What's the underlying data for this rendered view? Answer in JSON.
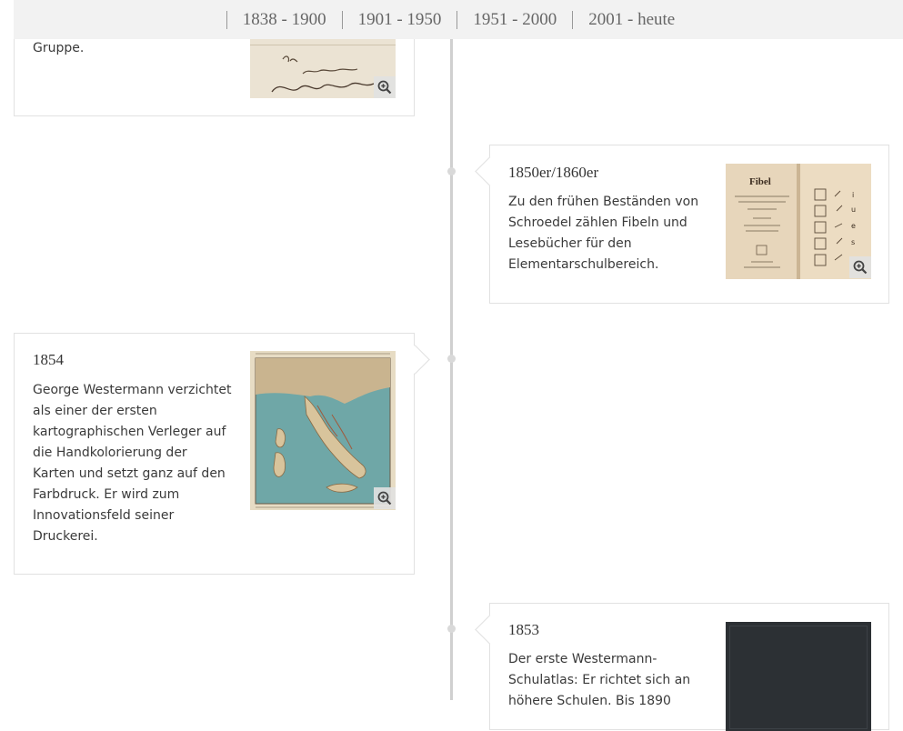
{
  "nav": {
    "items": [
      "1838 - 1900",
      "1901 - 1950",
      "1951 - 2000",
      "2001 - heute"
    ]
  },
  "cards": [
    {
      "year": "",
      "text": "Gruppe.",
      "image_label": "handwritten signature document",
      "handwriting": [
        "Ihr",
        "ergebenster",
        "Schroedel & Simon"
      ]
    },
    {
      "year": "1850er/1860er",
      "text": "Zu den frühen Beständen von Schroedel zählen Fibeln und Lesebücher für den Elementarschulbereich.",
      "image_label": "Fibel book pages",
      "book_title": "Fibel"
    },
    {
      "year": "1854",
      "text": "George Westermann verzichtet als einer der ersten kartographischen Verleger auf die Handkolorierung der Karten und setzt ganz auf den Farbdruck. Er wird zum Innovationsfeld seiner Druckerei.",
      "image_label": "Italy map"
    },
    {
      "year": "1853",
      "text": "Der erste Westermann-Schulatlas: Er richtet sich an höhere Schulen. Bis 1890",
      "image_label": "dark atlas cover"
    }
  ],
  "colors": {
    "nav_bg": "#f2f2f2",
    "line": "#d0d0d0",
    "card_border": "#e1e1e1"
  },
  "icons": {
    "zoom": "zoom-in-icon"
  }
}
